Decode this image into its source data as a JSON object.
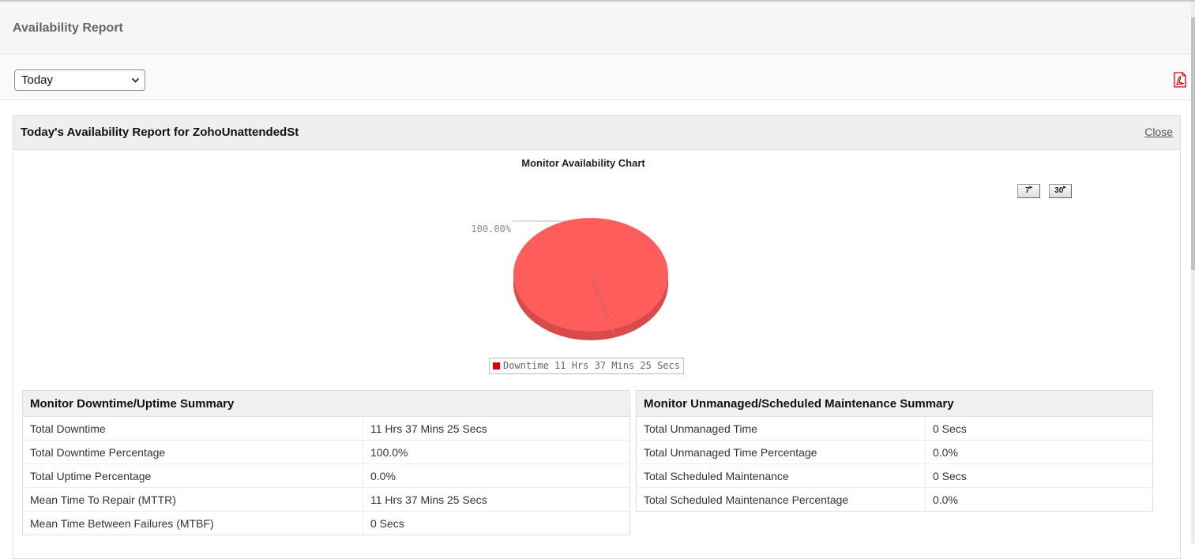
{
  "header": {
    "title": "Availability Report"
  },
  "toolbar": {
    "period_selected": "Today",
    "pdf_icon": "pdf-icon"
  },
  "panel": {
    "title": "Today's Availability Report for ZohoUnattendedSt",
    "close_label": "Close"
  },
  "chart_range_buttons": [
    {
      "label": "7",
      "arrow": "▸"
    },
    {
      "label": "30",
      "arrow": "▸"
    }
  ],
  "chart_data": {
    "type": "pie",
    "title": "Monitor Availability Chart",
    "slices": [
      {
        "label": "Downtime 11 Hrs 37 Mins 25 Secs",
        "value": 100.0,
        "display": "100.00%",
        "color": "#ff5c5c"
      }
    ],
    "legend_position": "bottom",
    "legend_color": "#e00000"
  },
  "downtime_summary": {
    "title": "Monitor Downtime/Uptime Summary",
    "rows": [
      {
        "label": "Total Downtime",
        "value": "11 Hrs 37 Mins 25 Secs"
      },
      {
        "label": "Total Downtime Percentage",
        "value": "100.0%"
      },
      {
        "label": "Total Uptime Percentage",
        "value": "0.0%"
      },
      {
        "label": "Mean Time To Repair (MTTR)",
        "value": "11 Hrs 37 Mins 25 Secs"
      },
      {
        "label": "Mean Time Between Failures (MTBF)",
        "value": "0 Secs"
      }
    ]
  },
  "maintenance_summary": {
    "title": "Monitor Unmanaged/Scheduled Maintenance Summary",
    "rows": [
      {
        "label": "Total Unmanaged Time",
        "value": "0 Secs"
      },
      {
        "label": "Total Unmanaged Time Percentage",
        "value": "0.0%"
      },
      {
        "label": "Total Scheduled Maintenance",
        "value": "0 Secs"
      },
      {
        "label": "Total Scheduled Maintenance Percentage",
        "value": "0.0%"
      }
    ]
  }
}
